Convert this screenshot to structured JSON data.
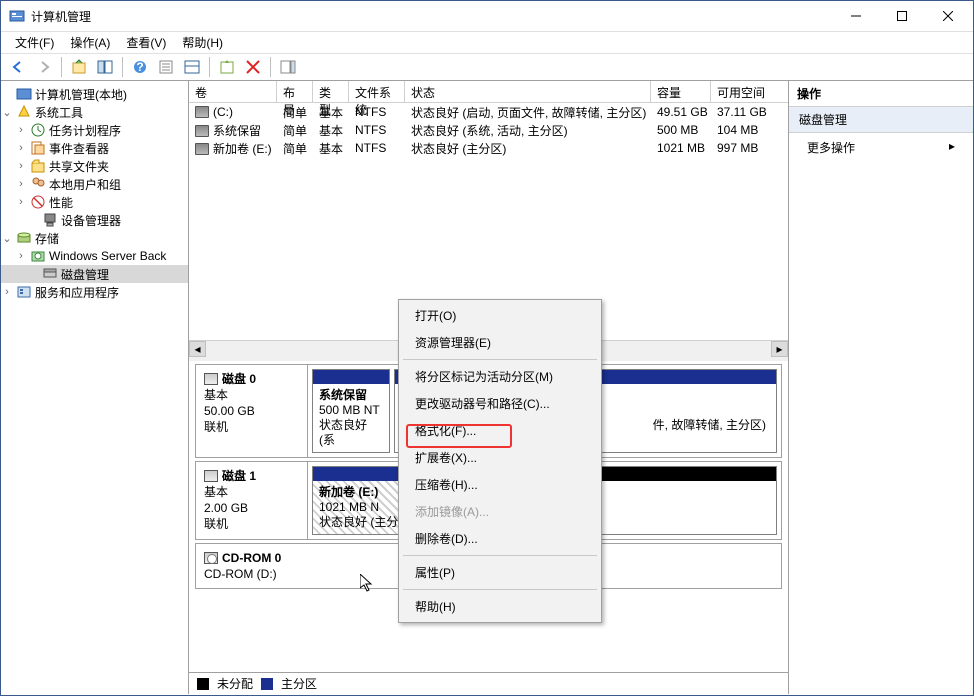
{
  "window": {
    "title": "计算机管理"
  },
  "menu": {
    "file": "文件(F)",
    "action": "操作(A)",
    "view": "查看(V)",
    "help": "帮助(H)"
  },
  "tree": {
    "root": "计算机管理(本地)",
    "sys_tools": "系统工具",
    "task_sched": "任务计划程序",
    "event_viewer": "事件查看器",
    "shared_folders": "共享文件夹",
    "local_users": "本地用户和组",
    "performance": "性能",
    "dev_mgr": "设备管理器",
    "storage": "存储",
    "wsb": "Windows Server Back",
    "disk_mgmt": "磁盘管理",
    "services": "服务和应用程序"
  },
  "list": {
    "cols": {
      "vol": "卷",
      "layout": "布局",
      "type": "类型",
      "fs": "文件系统",
      "status": "状态",
      "capacity": "容量",
      "free": "可用空间"
    },
    "rows": [
      {
        "vol": "(C:)",
        "layout": "简单",
        "type": "基本",
        "fs": "NTFS",
        "status": "状态良好 (启动, 页面文件, 故障转储, 主分区)",
        "capacity": "49.51 GB",
        "free": "37.11 GB"
      },
      {
        "vol": "系统保留",
        "layout": "简单",
        "type": "基本",
        "fs": "NTFS",
        "status": "状态良好 (系统, 活动, 主分区)",
        "capacity": "500 MB",
        "free": "104 MB"
      },
      {
        "vol": "新加卷 (E:)",
        "layout": "简单",
        "type": "基本",
        "fs": "NTFS",
        "status": "状态良好 (主分区)",
        "capacity": "1021 MB",
        "free": "997 MB"
      }
    ]
  },
  "disks": {
    "d0": {
      "name": "磁盘 0",
      "type": "基本",
      "size": "50.00 GB",
      "state": "联机",
      "p0": {
        "name": "系统保留",
        "sub": "500 MB NT",
        "stat": "状态良好 (系"
      },
      "p1_stat": "件, 故障转储, 主分区)"
    },
    "d1": {
      "name": "磁盘 1",
      "type": "基本",
      "size": "2.00 GB",
      "state": "联机",
      "p0": {
        "name": "新加卷  (E:)",
        "sub": "1021 MB N",
        "stat": "状态良好 (主分区)"
      },
      "p1": {
        "stat": "未分配"
      }
    },
    "cd": {
      "name": "CD-ROM 0",
      "sub": "CD-ROM (D:)"
    }
  },
  "legend": {
    "unalloc": "未分配",
    "primary": "主分区"
  },
  "actions": {
    "title": "操作",
    "section": "磁盘管理",
    "more": "更多操作"
  },
  "ctx": {
    "open": "打开(O)",
    "explorer": "资源管理器(E)",
    "mark_active": "将分区标记为活动分区(M)",
    "change_letter": "更改驱动器号和路径(C)...",
    "format": "格式化(F)...",
    "extend": "扩展卷(X)...",
    "shrink": "压缩卷(H)...",
    "mirror": "添加镜像(A)...",
    "delete": "删除卷(D)...",
    "props": "属性(P)",
    "help": "帮助(H)"
  }
}
